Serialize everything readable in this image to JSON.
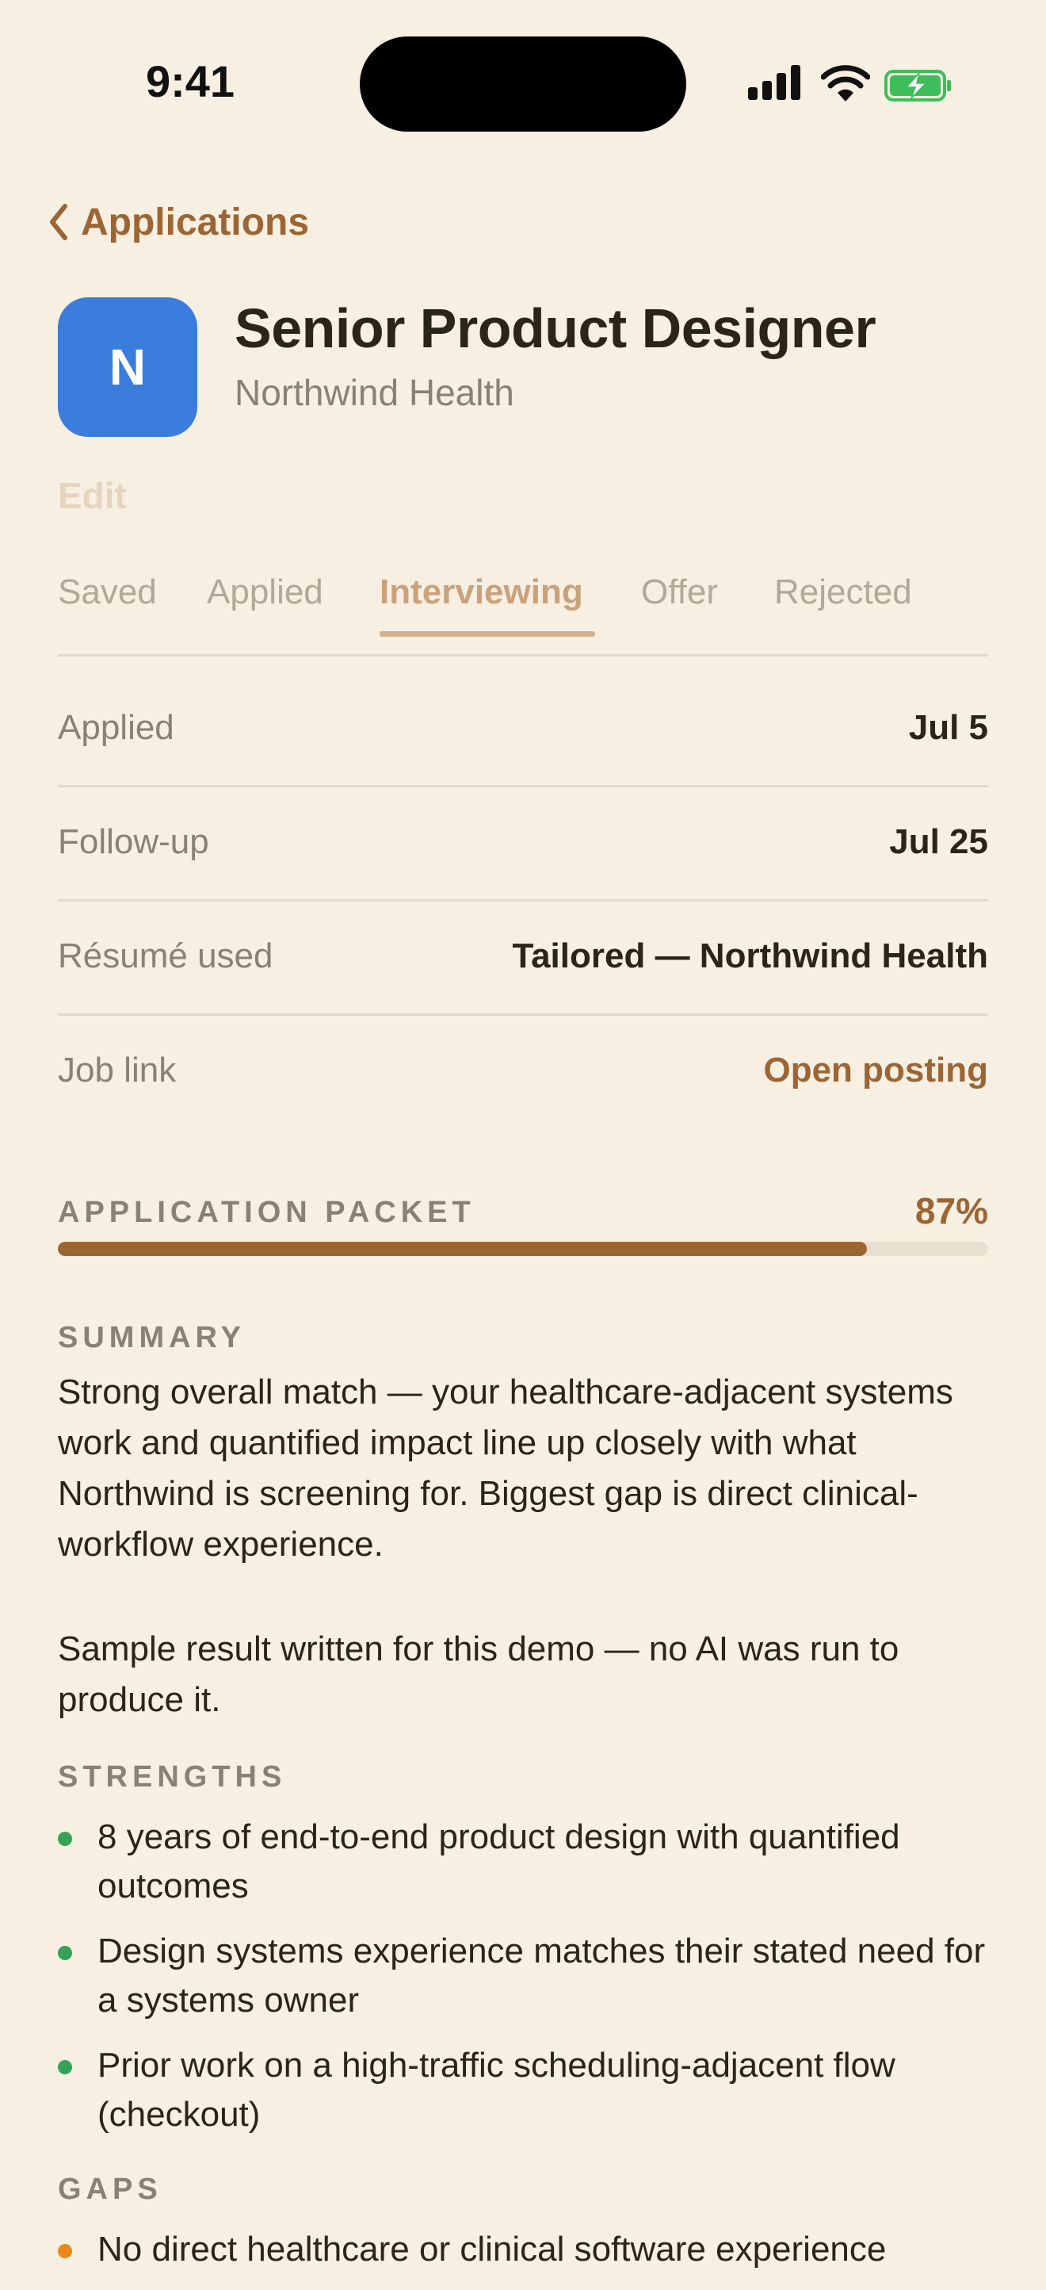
{
  "status_bar": {
    "time": "9:41"
  },
  "nav": {
    "back_label": "Applications"
  },
  "job": {
    "logo_letter": "N",
    "title": "Senior Product Designer",
    "company": "Northwind Health",
    "edit_label": "Edit"
  },
  "tabs": [
    {
      "label": "Saved"
    },
    {
      "label": "Applied"
    },
    {
      "label": "Interviewing",
      "active": true
    },
    {
      "label": "Offer"
    },
    {
      "label": "Rejected"
    }
  ],
  "details": {
    "applied": {
      "label": "Applied",
      "value": "Jul 5"
    },
    "followup": {
      "label": "Follow-up",
      "value": "Jul 25"
    },
    "resume": {
      "label": "Résumé used",
      "value": "Tailored — Northwind Health"
    },
    "job_link": {
      "label": "Job link",
      "value": "Open posting"
    }
  },
  "packet": {
    "label": "APPLICATION PACKET",
    "percent_label": "87%",
    "progress": 0.87
  },
  "summary": {
    "title": "SUMMARY",
    "text": "Strong overall match — your healthcare-adjacent systems work and quantified impact line up closely with what Northwind is screening for. Biggest gap is direct clinical-workflow experience.",
    "note": "Sample result written for this demo — no AI was run to produce it."
  },
  "strengths": {
    "title": "STRENGTHS",
    "items": [
      "8 years of end-to-end product design with quantified outcomes",
      "Design systems experience matches their stated need for a systems owner",
      "Prior work on a high-traffic scheduling-adjacent flow (checkout)"
    ]
  },
  "gaps": {
    "title": "GAPS",
    "items": [
      "No direct healthcare or clinical software experience"
    ]
  },
  "colors": {
    "accent": "#9C6534",
    "background": "#F6EFE2",
    "logo": "#3B7DDD",
    "strength_dot": "#34A356",
    "gap_dot": "#E88A1A"
  }
}
